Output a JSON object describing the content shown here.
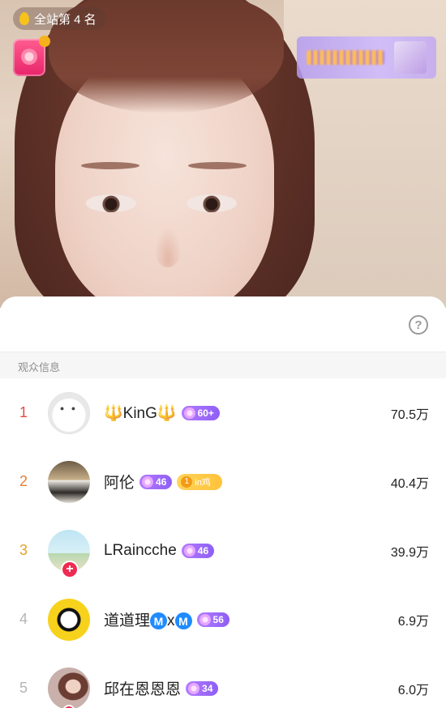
{
  "overlay": {
    "rank_text": "全站第 4 名",
    "colors": {
      "accent_pink": "#ee2b52",
      "level_purple": "#8e5ef5",
      "fan_yellow": "#ffc23a"
    }
  },
  "sheet": {
    "help_symbol": "?",
    "section_title": "观众信息"
  },
  "viewers": [
    {
      "rank": "1",
      "name": "🔱KinG🔱",
      "level": "60+",
      "fan_badge": "",
      "score": "70.5万"
    },
    {
      "rank": "2",
      "name": "阿伦",
      "level": "46",
      "fan_badge": "in鸡",
      "score": "40.4万"
    },
    {
      "rank": "3",
      "name": "LRaincche",
      "level": "46",
      "fan_badge": "",
      "score": "39.9万"
    },
    {
      "rank": "4",
      "name": "道道理",
      "name_badge_1": "M",
      "name_sep": "x",
      "name_badge_2": "M",
      "level": "56",
      "fan_badge": "",
      "score": "6.9万"
    },
    {
      "rank": "5",
      "name": "邱在恩恩恩",
      "level": "34",
      "fan_badge": "",
      "score": "6.0万"
    }
  ]
}
